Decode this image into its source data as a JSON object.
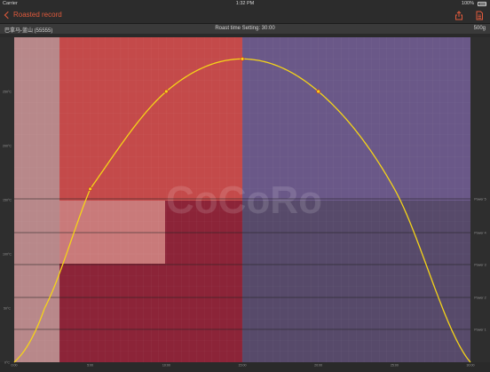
{
  "status_bar": {
    "carrier": "Carrier",
    "time": "1:32 PM",
    "battery": "100%"
  },
  "nav": {
    "back_label": "Roasted record",
    "share_icon": "share-icon",
    "document_icon": "document-icon"
  },
  "info": {
    "bean_name": "巴拿马-蓝山 (55555)",
    "roast_time": "Roast time Setting: 30:00",
    "weight": "500g"
  },
  "watermark": "CoCoRo",
  "colors": {
    "accent": "#e05a3c",
    "curve": "#f5d418",
    "zone_light": "#b8888a",
    "zone_red": "#c44a4a",
    "zone_dark_red": "#8c2438",
    "zone_purple": "#6a5888"
  },
  "chart_data": {
    "type": "line",
    "y_tick_labels": [
      "0°C",
      "50°C",
      "100°C",
      "150°C",
      "200°C",
      "250°C"
    ],
    "x_tick_labels": [
      "0:00",
      "5:00",
      "10:00",
      "15:00",
      "20:00",
      "25:00",
      "30:00"
    ],
    "power_labels": [
      "Power 1",
      "Power 2",
      "Power 3",
      "Power 4",
      "Power 5"
    ],
    "series": [
      {
        "values_description": "temperature",
        "points": [
          [
            0,
            0
          ],
          [
            2,
            50
          ],
          [
            5,
            160
          ],
          [
            10,
            250
          ],
          [
            15,
            280
          ],
          [
            20,
            250
          ],
          [
            25,
            160
          ],
          [
            30,
            0
          ]
        ]
      }
    ],
    "markers": [
      [
        5,
        160
      ],
      [
        10,
        250
      ],
      [
        15,
        280
      ],
      [
        20,
        250
      ]
    ],
    "xlim": [
      0,
      30
    ],
    "ylim": [
      0,
      300
    ],
    "grid": true
  }
}
